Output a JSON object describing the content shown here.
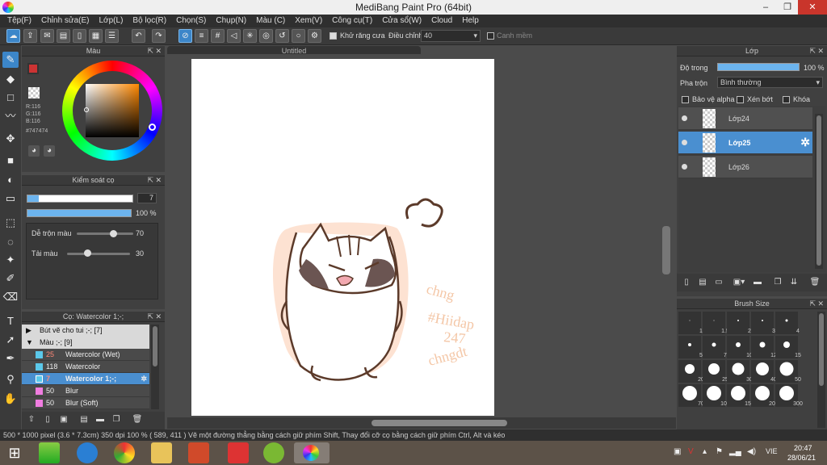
{
  "window": {
    "title": "MediBang Paint Pro (64bit)",
    "minimize": "–",
    "restore": "❐",
    "close": "✕"
  },
  "menu": [
    "Tệp(F)",
    "Chỉnh sửa(E)",
    "Lớp(L)",
    "Bộ lọc(R)",
    "Chọn(S)",
    "Chụp(N)",
    "Màu (C)",
    "Xem(V)",
    "Công cụ(T)",
    "Cửa sổ(W)",
    "Cloud",
    "Help"
  ],
  "toolbar": {
    "antialias_label": "Khử răng cưa",
    "adjust_label": "Điều chỉnh",
    "adjust_value": "40",
    "smooth_label": "Canh mềm"
  },
  "color_panel": {
    "title": "Màu",
    "r": "R:116",
    "g": "G:116",
    "b": "B:116",
    "hex": "#747474",
    "current_color": "#747474"
  },
  "brush_control": {
    "title": "Kiểm soát cọ",
    "size": "7",
    "opacity": "100 %",
    "blend_label": "Dễ trộn màu",
    "blend_value": "70",
    "fill_label": "Tải màu",
    "fill_value": "30"
  },
  "brush_list": {
    "title": "Cọ: Watercolor 1;-;",
    "groups": [
      {
        "name": "Bút vẽ cho tui ;-; [7]",
        "arrow": "▶"
      },
      {
        "name": "Màu ;-; [9]",
        "arrow": "▼"
      }
    ],
    "items": [
      {
        "size": "25",
        "name": "Watercolor (Wet)",
        "color": "#5bc8ea"
      },
      {
        "size": "118",
        "name": "Watercolor",
        "color": "#5bc8ea"
      },
      {
        "size": "7",
        "name": "Watercolor 1;-;",
        "color": "#5bc8ea"
      },
      {
        "size": "50",
        "name": "Blur",
        "color": "#f07de0"
      },
      {
        "size": "50",
        "name": "Blur (Soft)",
        "color": "#f07de0"
      }
    ]
  },
  "canvas": {
    "tab": "Untitled"
  },
  "layers": {
    "title": "Lớp",
    "opacity_label": "Độ trong",
    "opacity_value": "100 %",
    "blend_label": "Pha trộn",
    "blend_value": "Bình thường",
    "protect_alpha": "Bảo vệ alpha",
    "clipping": "Xén bớt",
    "lock": "Khóa",
    "items": [
      {
        "name": "Lớp24",
        "selected": false
      },
      {
        "name": "Lớp25",
        "selected": true
      },
      {
        "name": "Lớp26",
        "selected": false
      }
    ]
  },
  "brush_size": {
    "title": "Brush Size",
    "sizes": [
      "1",
      "1.5",
      "2",
      "3",
      "4",
      "5",
      "7",
      "10",
      "12",
      "15",
      "20",
      "25",
      "30",
      "40",
      "50",
      "70",
      "100",
      "150",
      "200",
      "300"
    ]
  },
  "status": {
    "text": "500 * 1000 pixel   (3.6 * 7.3cm)   350 dpi   100 %   ( 589, 411 )   Vẽ một đường thẳng bằng cách giữ phím Shift, Thay đổi cỡ cọ bằng cách giữ phím Ctrl, Alt và kéo"
  },
  "taskbar": {
    "lang": "VIE",
    "time": "20:47",
    "date": "28/06/21"
  }
}
